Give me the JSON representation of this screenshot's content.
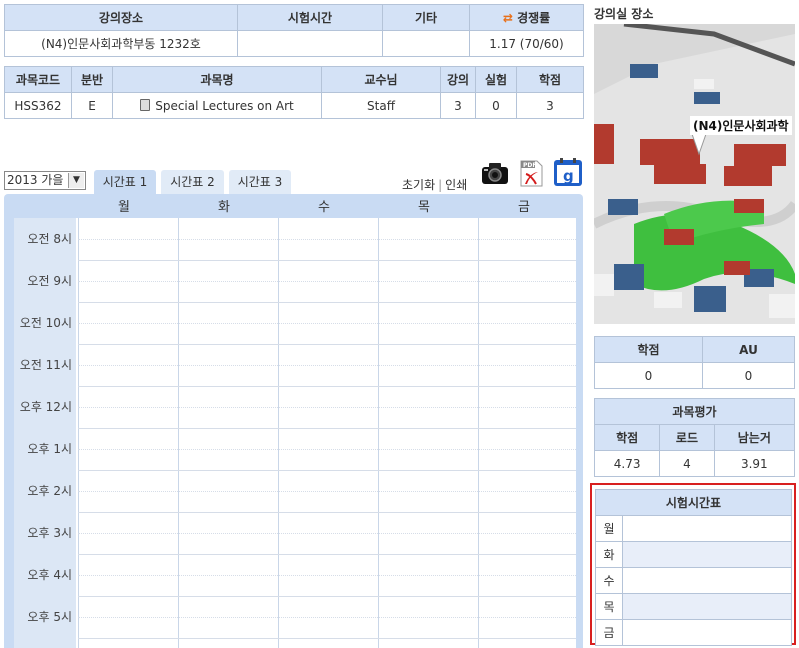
{
  "course_info": {
    "headers": [
      "강의장소",
      "시험시간",
      "기타",
      "경쟁률"
    ],
    "values": [
      "(N4)인문사회과학부동 1232호",
      "",
      "",
      "1.17 (70/60)"
    ]
  },
  "course": {
    "headers": [
      "과목코드",
      "분반",
      "과목명",
      "교수님",
      "강의",
      "실험",
      "학점"
    ],
    "values": [
      "HSS362",
      "E",
      "Special Lectures on Art",
      "Staff",
      "3",
      "0",
      "3"
    ]
  },
  "semester": "2013 가을",
  "tabs": [
    "시간표 1",
    "시간표 2",
    "시간표 3"
  ],
  "active_tab": 0,
  "links": {
    "reset": "초기화",
    "print": "인쇄"
  },
  "icons": [
    "camera-icon",
    "pdf-icon",
    "google-calendar-icon"
  ],
  "timetable": {
    "days": [
      "월",
      "화",
      "수",
      "목",
      "금"
    ],
    "times": [
      "오전 8시",
      "오전 9시",
      "오전 10시",
      "오전 11시",
      "오후 12시",
      "오후 1시",
      "오후 2시",
      "오후 3시",
      "오후 4시",
      "오후 5시"
    ]
  },
  "map": {
    "label": "강의실 장소",
    "tag": "(N4)인문사회과학"
  },
  "credits": {
    "headers": [
      "학점",
      "AU"
    ],
    "values": [
      "0",
      "0"
    ]
  },
  "evaluation": {
    "title": "과목평가",
    "headers": [
      "학점",
      "로드",
      "남는거"
    ],
    "values": [
      "4.73",
      "4",
      "3.91"
    ]
  },
  "exam_schedule": {
    "title": "시험시간표",
    "days": [
      "월",
      "화",
      "수",
      "목",
      "금"
    ]
  },
  "colors": {
    "header_bg": "#d4e2f6",
    "border": "#b4c3d8",
    "timetable_bg": "#c9dbf3",
    "highlight_border": "#d82020"
  }
}
